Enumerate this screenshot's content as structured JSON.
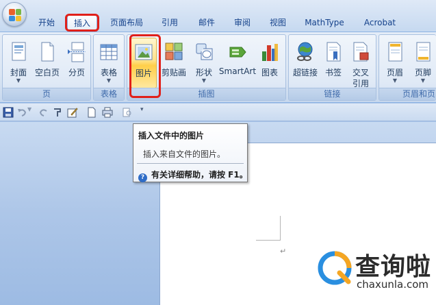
{
  "tabs": [
    {
      "label": "开始"
    },
    {
      "label": "插入"
    },
    {
      "label": "页面布局"
    },
    {
      "label": "引用"
    },
    {
      "label": "邮件"
    },
    {
      "label": "审阅"
    },
    {
      "label": "视图"
    },
    {
      "label": "MathType"
    },
    {
      "label": "Acrobat"
    }
  ],
  "active_tab": "插入",
  "ribbon": {
    "pages_group": {
      "label": "页",
      "buttons": [
        {
          "label": "封面",
          "icon": "cover-page-icon",
          "has_dropdown": true
        },
        {
          "label": "空白页",
          "icon": "blank-page-icon"
        },
        {
          "label": "分页",
          "icon": "page-break-icon"
        }
      ]
    },
    "tables_group": {
      "label": "表格",
      "buttons": [
        {
          "label": "表格",
          "icon": "table-icon",
          "has_dropdown": true
        }
      ]
    },
    "illustrations_group": {
      "label": "插图",
      "buttons": [
        {
          "label": "图片",
          "icon": "picture-icon"
        },
        {
          "label": "剪贴画",
          "icon": "clip-art-icon"
        },
        {
          "label": "形状",
          "icon": "shapes-icon",
          "has_dropdown": true
        },
        {
          "label": "SmartArt",
          "icon": "smartart-icon"
        },
        {
          "label": "图表",
          "icon": "chart-icon"
        }
      ]
    },
    "links_group": {
      "label": "链接",
      "buttons": [
        {
          "label": "超链接",
          "icon": "hyperlink-icon"
        },
        {
          "label": "书签",
          "icon": "bookmark-icon"
        },
        {
          "label": "交叉",
          "label2": "引用",
          "icon": "cross-reference-icon"
        }
      ]
    },
    "header_footer_group": {
      "label": "页眉和页",
      "buttons": [
        {
          "label": "页眉",
          "icon": "header-icon",
          "has_dropdown": true
        },
        {
          "label": "页脚",
          "icon": "footer-icon",
          "has_dropdown": true
        }
      ]
    }
  },
  "tooltip": {
    "title": "插入文件中的图片",
    "description": "插入来自文件的图片。",
    "help_text": "有关详细帮助，请按 F1。"
  },
  "watermark": {
    "name": "查询啦",
    "url": "chaxunla.com"
  },
  "colors": {
    "highlight_red": "#e0201a",
    "ribbon_blue": "#dbe6f4",
    "hot_button": "#ffcf4a"
  }
}
